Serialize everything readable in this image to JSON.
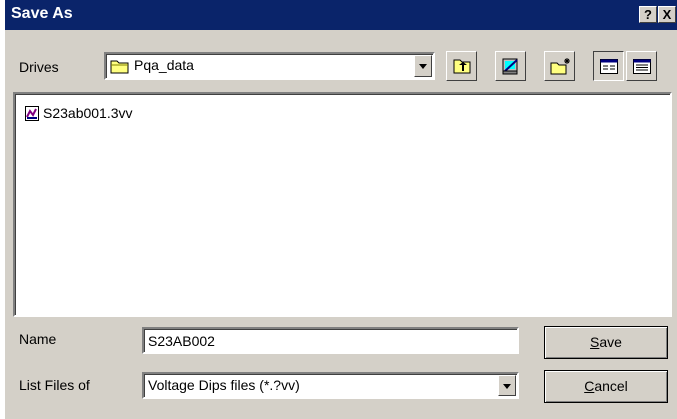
{
  "window": {
    "title": "Save As",
    "help_glyph": "?",
    "close_glyph": "X"
  },
  "drives": {
    "label": "Drives",
    "selected": "Pqa_data"
  },
  "toolbar": {
    "icons": [
      "up-folder-icon",
      "network-icon",
      "new-folder-icon",
      "list-view-icon",
      "details-view-icon"
    ]
  },
  "files": [
    {
      "name": "S23ab001.3vv",
      "icon": "file-icon"
    }
  ],
  "name_row": {
    "label": "Name",
    "value": "S23AB002"
  },
  "list_files_row": {
    "label": "List Files of",
    "selected": "Voltage Dips files (*.?vv)"
  },
  "buttons": {
    "save_first": "S",
    "save_rest": "ave",
    "cancel_first": "C",
    "cancel_rest": "ancel"
  }
}
